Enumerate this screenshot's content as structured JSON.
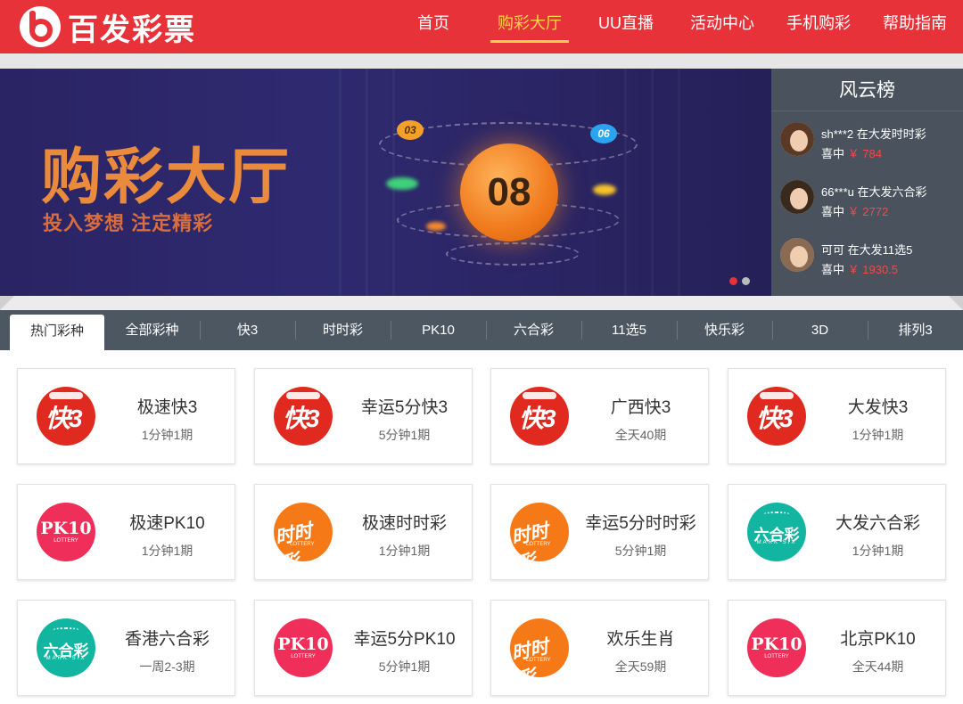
{
  "header": {
    "logo_text": "百发彩票",
    "nav": [
      {
        "label": "首页",
        "active": false
      },
      {
        "label": "购彩大厅",
        "active": true
      },
      {
        "label": "UU直播",
        "active": false
      },
      {
        "label": "活动中心",
        "active": false
      },
      {
        "label": "手机购彩",
        "active": false
      },
      {
        "label": "帮助指南",
        "active": false
      }
    ]
  },
  "banner": {
    "title": "购彩大厅",
    "subtitle": "投入梦想  注定精彩",
    "main_ball": "08",
    "ball_a": "03",
    "ball_b": "06"
  },
  "ranking": {
    "title": "风云榜",
    "items": [
      {
        "user": "sh***2 在大发时时彩",
        "win_label": "喜中",
        "amount": "￥ 784"
      },
      {
        "user": "66***u 在大发六合彩",
        "win_label": "喜中",
        "amount": "￥ 2772"
      },
      {
        "user": "可可 在大发11选5",
        "win_label": "喜中",
        "amount": "￥ 1930.5"
      }
    ]
  },
  "tabs": [
    "热门彩种",
    "全部彩种",
    "快3",
    "时时彩",
    "PK10",
    "六合彩",
    "11选5",
    "快乐彩",
    "3D",
    "排列3"
  ],
  "logo_labels": {
    "k3": "快3",
    "pk10": "PK10",
    "pk10_sub": "LOTTERY",
    "ssc": "时时彩",
    "ssc_sub": "LOTTERY",
    "lhc": "六合彩",
    "lhc_sub": "MARK SIX"
  },
  "cards": [
    {
      "name": "极速快3",
      "period": "1分钟1期",
      "logo": "k3"
    },
    {
      "name": "幸运5分快3",
      "period": "5分钟1期",
      "logo": "k3"
    },
    {
      "name": "广西快3",
      "period": "全天40期",
      "logo": "k3"
    },
    {
      "name": "大发快3",
      "period": "1分钟1期",
      "logo": "k3"
    },
    {
      "name": "极速PK10",
      "period": "1分钟1期",
      "logo": "pk10"
    },
    {
      "name": "极速时时彩",
      "period": "1分钟1期",
      "logo": "ssc"
    },
    {
      "name": "幸运5分时时彩",
      "period": "5分钟1期",
      "logo": "ssc"
    },
    {
      "name": "大发六合彩",
      "period": "1分钟1期",
      "logo": "lhc"
    },
    {
      "name": "香港六合彩",
      "period": "一周2-3期",
      "logo": "lhc"
    },
    {
      "name": "幸运5分PK10",
      "period": "5分钟1期",
      "logo": "pk10"
    },
    {
      "name": "欢乐生肖",
      "period": "全天59期",
      "logo": "ssc"
    },
    {
      "name": "北京PK10",
      "period": "全天44期",
      "logo": "pk10"
    }
  ]
}
